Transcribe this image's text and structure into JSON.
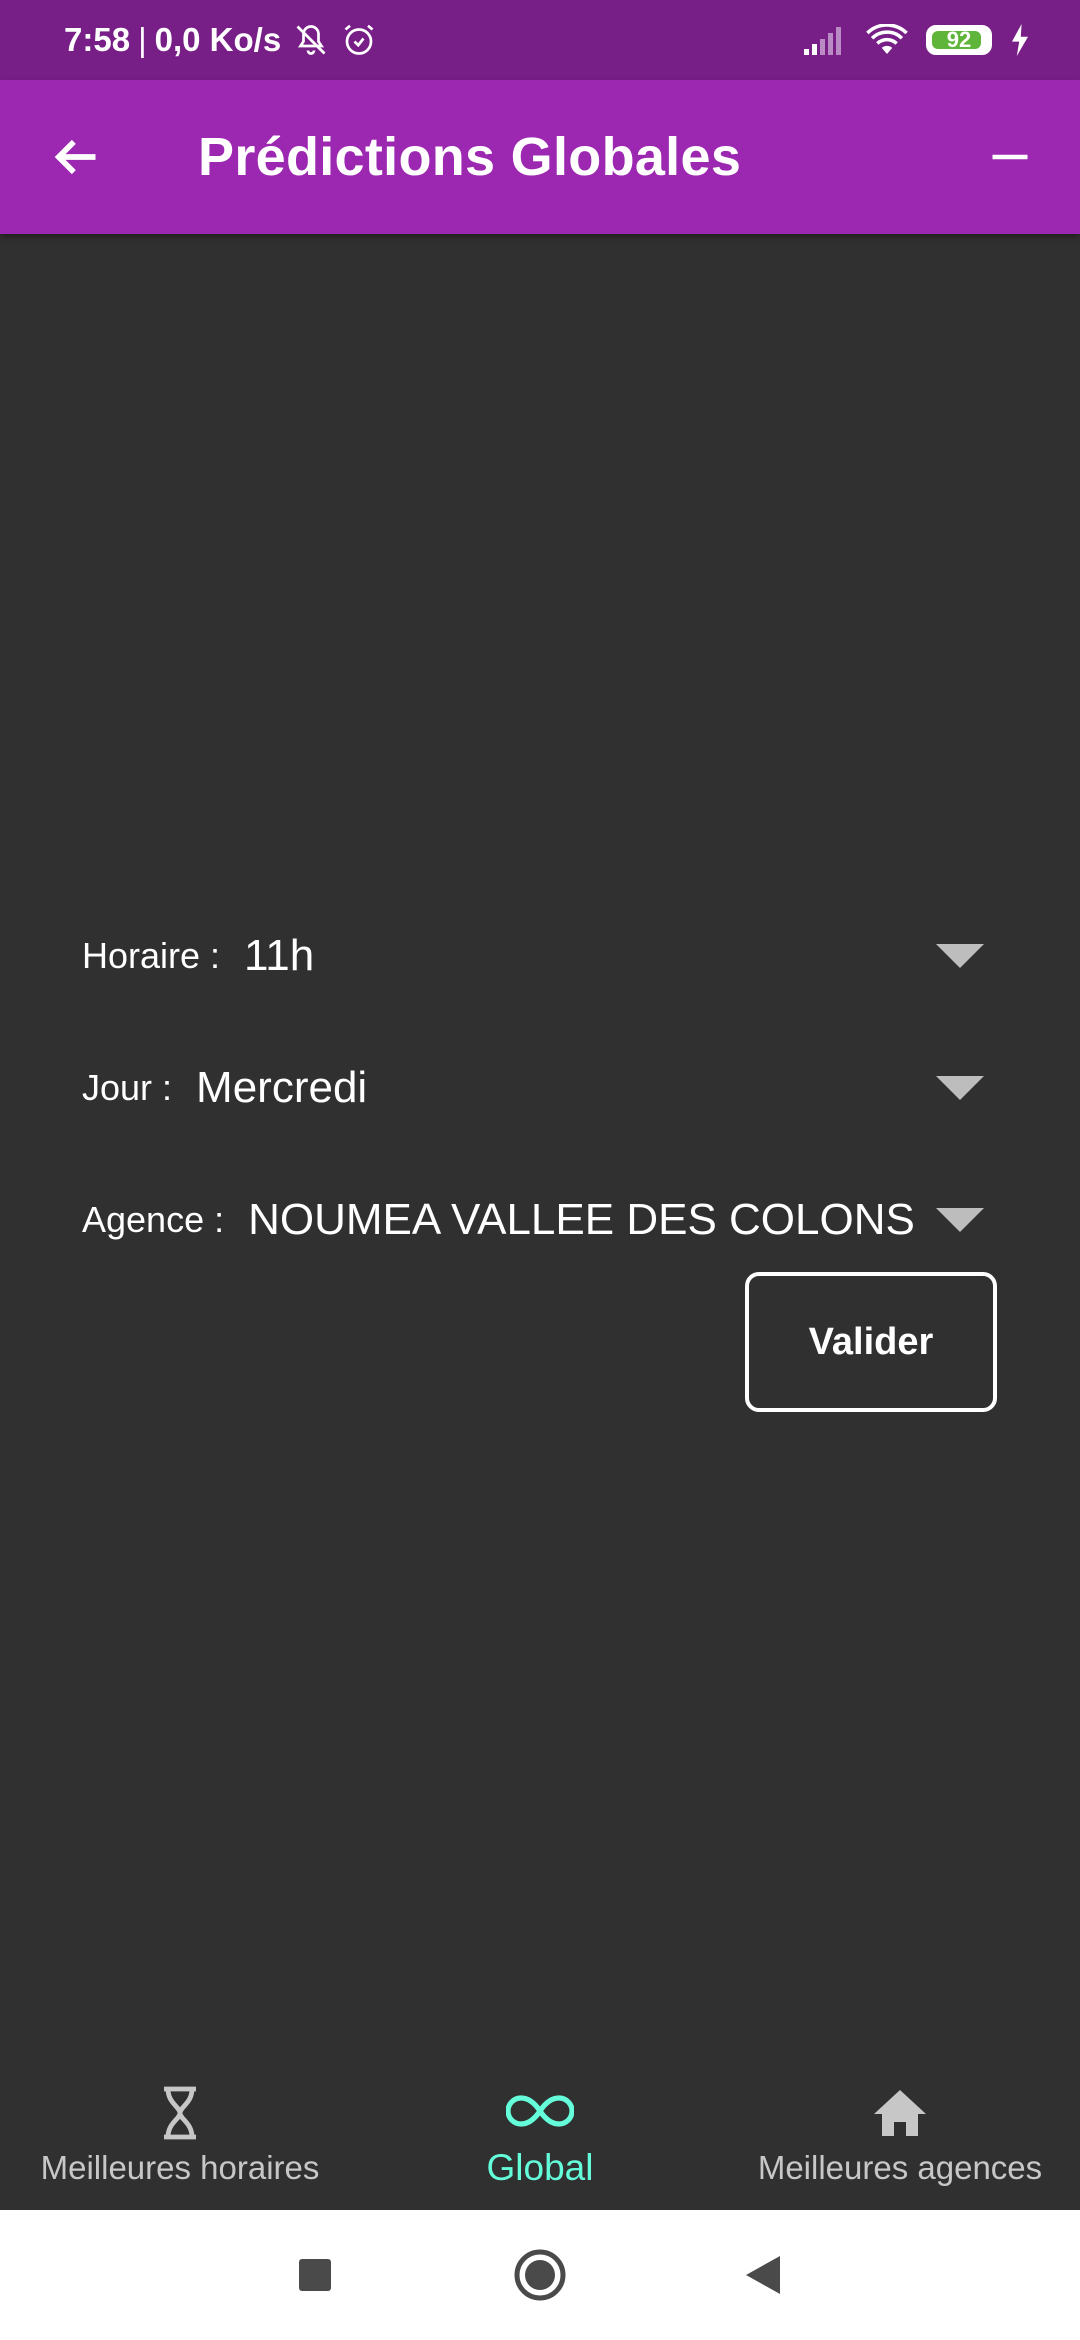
{
  "status_bar": {
    "time": "7:58",
    "separator": "|",
    "network_speed": "0,0 Ko/s",
    "battery_level": "92",
    "battery_percent": 92,
    "icons": [
      "bell-off-icon",
      "alarm-icon",
      "signal-icon",
      "wifi-icon",
      "battery-icon",
      "charging-icon"
    ]
  },
  "app_bar": {
    "title": "Prédictions Globales",
    "back_icon": "arrow-back-icon",
    "action_icon": "minus-icon"
  },
  "form": {
    "horaire": {
      "label": "Horaire :",
      "value": "11h"
    },
    "jour": {
      "label": "Jour :",
      "value": "Mercredi"
    },
    "agence": {
      "label": "Agence :",
      "value": "NOUMEA VALLEE DES COLONS"
    },
    "submit_label": "Valider"
  },
  "bottom_nav": {
    "items": [
      {
        "label": "Meilleures horaires",
        "icon": "hourglass-icon",
        "active": false
      },
      {
        "label": "Global",
        "icon": "infinity-icon",
        "active": true
      },
      {
        "label": "Meilleures agences",
        "icon": "home-icon",
        "active": false
      }
    ]
  },
  "system_nav": {
    "icons": [
      "recents-icon",
      "home-circle-icon",
      "back-triangle-icon"
    ]
  },
  "colors": {
    "status_bar": "#771e87",
    "app_bar": "#9c27b0",
    "background": "#303030",
    "accent": "#64ffda",
    "battery": "#5fb53a"
  }
}
